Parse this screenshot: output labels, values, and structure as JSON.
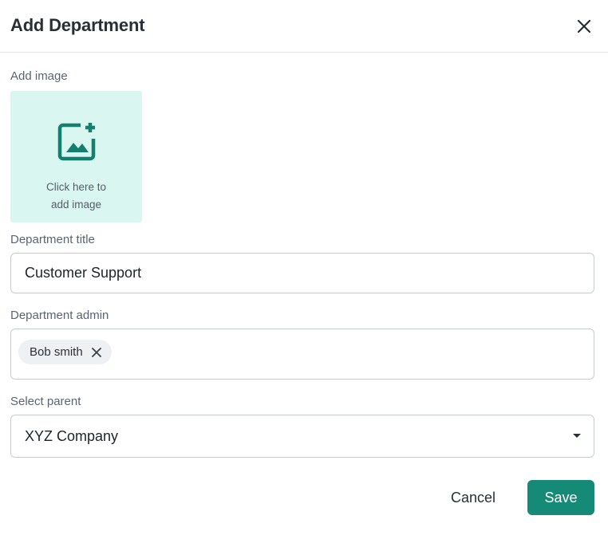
{
  "dialog": {
    "title": "Add Department",
    "close_icon": "close-icon"
  },
  "image_upload": {
    "label": "Add image",
    "hint_line1": "Click here to",
    "hint_line2": "add image",
    "icon": "add-image-icon",
    "accent_color": "#13806e",
    "background_color": "#d9f6f1"
  },
  "department_title": {
    "label": "Department title",
    "value": "Customer Support"
  },
  "department_admin": {
    "label": "Department admin",
    "chips": [
      {
        "label": "Bob smith",
        "remove_icon": "close-icon"
      }
    ]
  },
  "select_parent": {
    "label": "Select parent",
    "value": "XYZ Company",
    "caret_icon": "caret-down-icon"
  },
  "actions": {
    "cancel_label": "Cancel",
    "save_label": "Save",
    "save_color": "#158a76"
  }
}
